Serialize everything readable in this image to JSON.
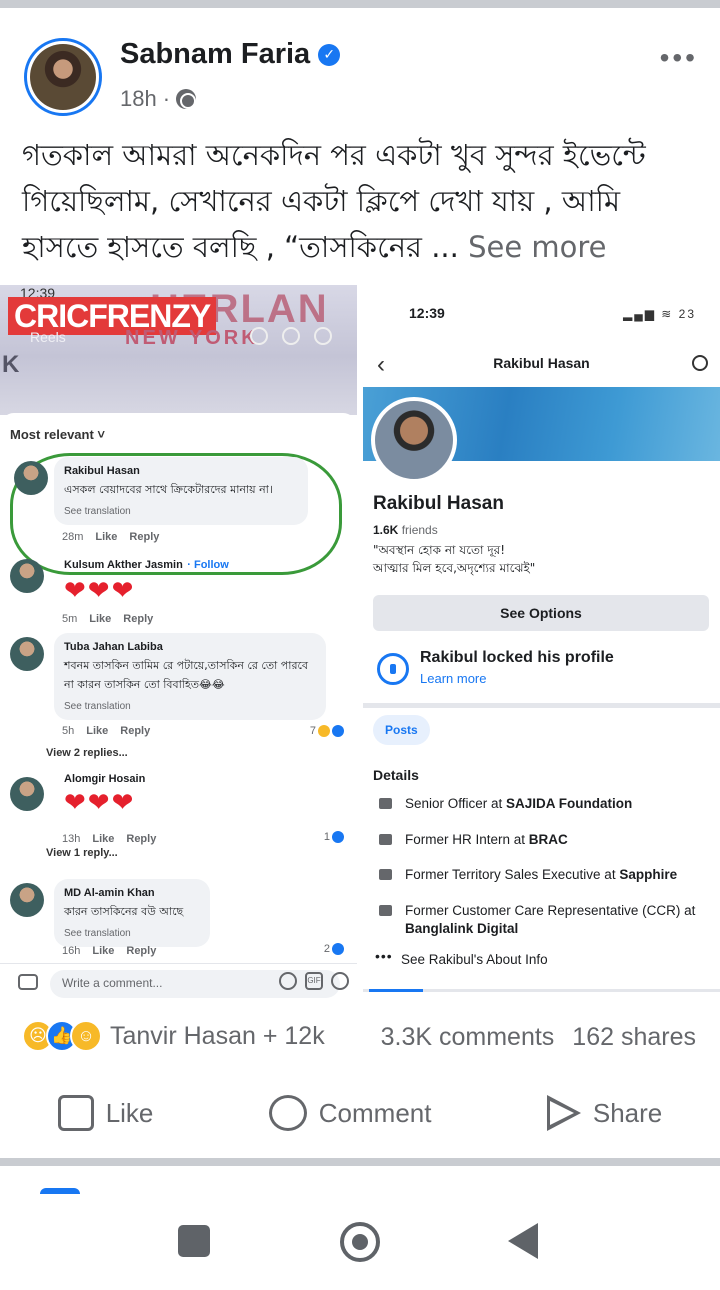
{
  "post": {
    "author": "Sabnam Faria",
    "time": "18h",
    "privacy_separator": "·",
    "more": "•••",
    "text": "গতকাল আমরা অনেকদিন পর একটা খুব সুন্দর ইভেন্টে গিয়েছিলাম, সেখানের একটা ক্লিপে দেখা যায় , আমি হাসতে হাসতে বলছি , “তাসকিনের ...",
    "see_more": "See more"
  },
  "left_shot": {
    "time": "12:39",
    "brand": "CRICFRENZY",
    "reels_label": "Reels",
    "banner_text": "NEW YORK",
    "banner_big": "HERLAN",
    "edge_letter": "K",
    "sort_label": "Most relevant ˅",
    "comments": [
      {
        "name": "Rakibul Hasan",
        "text": "এসকল বেয়াদবের সাথে ক্রিকেটারদের মানায় না।",
        "translation": "See translation",
        "time": "28m",
        "like": "Like",
        "reply": "Reply"
      },
      {
        "name": "Kulsum Akther Jasmin",
        "follow": "· Follow",
        "hearts": "❤❤❤",
        "time": "5m",
        "like": "Like",
        "reply": "Reply"
      },
      {
        "name": "Tuba Jahan Labiba",
        "text": "শবনম তাসকিন তামিম রে পটায়ে,তাসকিন রে তো পারবে না কারন তাসকিন তো বিবাহিত😂😂",
        "translation": "See translation",
        "time": "5h",
        "like": "Like",
        "reply": "Reply",
        "reacts": "7",
        "view_replies": "View 2 replies..."
      },
      {
        "name": "Alomgir Hosain",
        "hearts": "❤❤❤",
        "time": "13h",
        "like": "Like",
        "reply": "Reply",
        "reacts": "1",
        "view_replies": "View 1 reply..."
      },
      {
        "name": "MD Al-amin Khan",
        "text": "কারন তাসকিনের বউ আছে",
        "translation": "See translation",
        "time": "16h",
        "like": "Like",
        "reply": "Reply",
        "reacts": "2"
      }
    ],
    "write_placeholder": "Write a comment...",
    "gif": "GIF"
  },
  "right_shot": {
    "time": "12:39",
    "signal": "▂▄▆ ≋ 23",
    "nav_title": "Rakibul Hasan",
    "name": "Rakibul Hasan",
    "friends_count": "1.6K",
    "friends_label": "friends",
    "bio_line1": "\"অবস্থান হোক না যতো দূর!",
    "bio_line2": "আত্মার মিল হবে,অদৃশ্যের মাঝেই\"",
    "see_options": "See Options",
    "locked_title": "Rakibul locked his profile",
    "learn_more": "Learn more",
    "posts_tab": "Posts",
    "details_title": "Details",
    "details": [
      {
        "prefix": "Senior Officer at ",
        "bold": "SAJIDA Foundation"
      },
      {
        "prefix": "Former HR Intern at ",
        "bold": "BRAC"
      },
      {
        "prefix": "Former Territory Sales Executive at ",
        "bold": "Sapphire"
      },
      {
        "prefix": "Former Customer Care Representative (CCR) at ",
        "bold": "Banglalink Digital"
      }
    ],
    "about_dots": "•••",
    "about_link": "See Rakibul's About Info"
  },
  "reactions": {
    "names": "Tanvir Hasan + 12k",
    "comments": "3.3K comments",
    "shares": "162 shares"
  },
  "actions": {
    "like": "Like",
    "comment": "Comment",
    "share": "Share"
  }
}
